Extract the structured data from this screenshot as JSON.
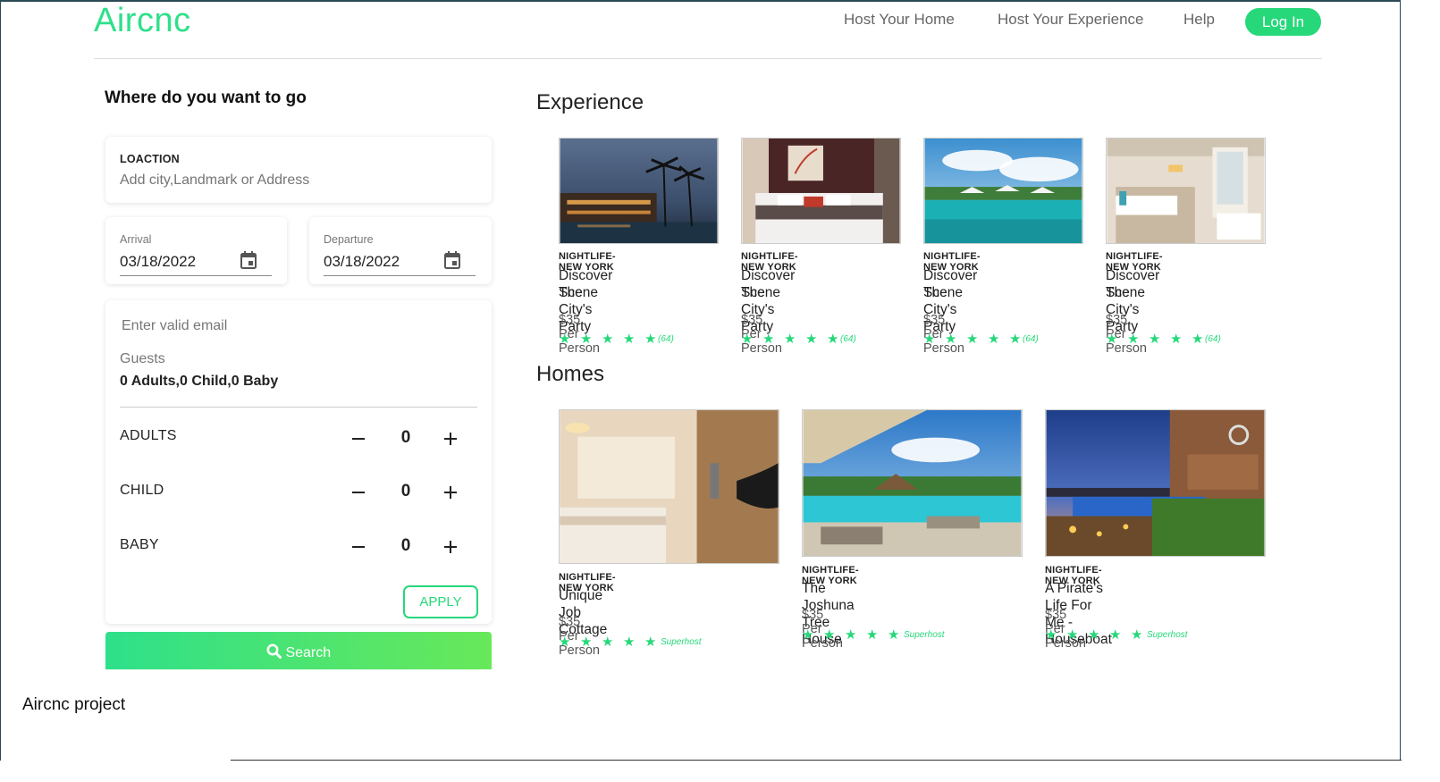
{
  "app": {
    "logo": "Aircnc",
    "caption": "Aircnc project"
  },
  "nav": {
    "items": [
      "Host Your Home",
      "Host Your Experience",
      "Help"
    ],
    "login": "Log In"
  },
  "search_panel": {
    "heading": "Where do you want to go",
    "location_label": "LOACTION",
    "location_placeholder": "Add city,Landmark or Address",
    "arrival_label": "Arrival",
    "arrival_value": "03/18/2022",
    "departure_label": "Departure",
    "departure_value": "03/18/2022",
    "email_placeholder": "Enter valid email",
    "guests_label": "Guests",
    "guests_summary": "0 Adults,0 Child,0 Baby",
    "rows": [
      {
        "label": "ADULTS",
        "count": "0"
      },
      {
        "label": "CHILD",
        "count": "0"
      },
      {
        "label": "BABY",
        "count": "0"
      }
    ],
    "apply": "APPLY",
    "search": "Search"
  },
  "experience": {
    "title": "Experience",
    "items": [
      {
        "tag": "NIGHTLIFE-NEW YORK",
        "name_line1": "Discover The City's Party",
        "name_line2": "Scene",
        "price": "$35 Per Person",
        "rating_meta": "(64)",
        "stars": 5
      },
      {
        "tag": "NIGHTLIFE-NEW YORK",
        "name_line1": "Discover The City's Party",
        "name_line2": "Scene",
        "price": "$35 Per Person",
        "rating_meta": "(64)",
        "stars": 5
      },
      {
        "tag": "NIGHTLIFE-NEW YORK",
        "name_line1": "Discover The City's Party",
        "name_line2": "Scene",
        "price": "$35 Per Person",
        "rating_meta": "(64)",
        "stars": 5
      },
      {
        "tag": "NIGHTLIFE-NEW YORK",
        "name_line1": "Discover The City's Party",
        "name_line2": "Scene",
        "price": "$35 Per Person",
        "rating_meta": "(64)",
        "stars": 5
      }
    ]
  },
  "homes": {
    "title": "Homes",
    "items": [
      {
        "tag": "NIGHTLIFE-NEW YORK",
        "name": "Unique Job Cottage",
        "price": "$35 Per Person",
        "rating_meta": "Superhost",
        "stars": 5
      },
      {
        "tag": "NIGHTLIFE-NEW YORK",
        "name": "The Joshuna Tree House",
        "price": "$35 Per Person",
        "rating_meta": "Superhost",
        "stars": 5
      },
      {
        "tag": "NIGHTLIFE-NEW YORK",
        "name": "A Pirate's Life For Me - Houseboat",
        "price": "$35 Per Person",
        "rating_meta": "Superhost",
        "stars": 5
      }
    ]
  },
  "icons": {
    "calendar": "calendar-icon",
    "search": "search-icon",
    "star": "star-icon"
  },
  "colors": {
    "accent": "#26d87a",
    "logo": "#2ee08a"
  }
}
